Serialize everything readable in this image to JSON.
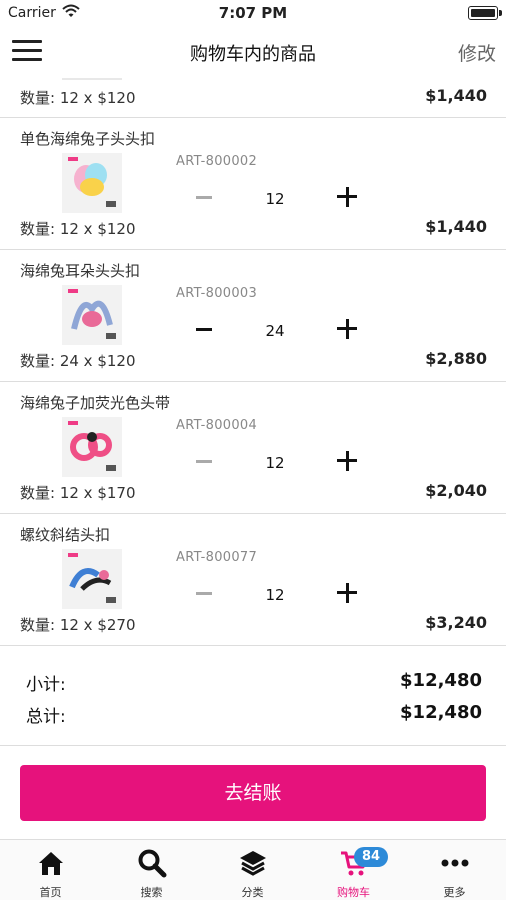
{
  "status_bar": {
    "carrier": "Carrier",
    "time": "7:07 PM"
  },
  "nav": {
    "title": "购物车内的商品",
    "edit_label": "修改"
  },
  "partial_item": {
    "line": "数量: 12 x $120",
    "total": "$1,440"
  },
  "items": [
    {
      "name": "单色海绵兔子头头扣",
      "sku": "ART-800002",
      "qty": "12",
      "line": "数量: 12 x $120",
      "total": "$1,440",
      "minus_active": false,
      "thumb_color": "#f3b3c9"
    },
    {
      "name": "海绵兔耳朵头头扣",
      "sku": "ART-800003",
      "qty": "24",
      "line": "数量: 24 x $120",
      "total": "$2,880",
      "minus_active": true,
      "thumb_color": "#8fa6d6"
    },
    {
      "name": "海绵兔子加荧光色头带",
      "sku": "ART-800004",
      "qty": "12",
      "line": "数量: 12 x $170",
      "total": "$2,040",
      "minus_active": false,
      "thumb_color": "#ef4f86"
    },
    {
      "name": "螺纹斜结头扣",
      "sku": "ART-800077",
      "qty": "12",
      "line": "数量: 12 x $270",
      "total": "$3,240",
      "minus_active": false,
      "thumb_color": "#3f7fd4"
    }
  ],
  "summary": {
    "subtotal_label": "小计:",
    "subtotal_value": "$12,480",
    "total_label": "总计:",
    "total_value": "$12,480"
  },
  "checkout": {
    "label": "去结账"
  },
  "tabs": [
    {
      "label": "首页",
      "icon": "home-icon"
    },
    {
      "label": "搜索",
      "icon": "search-icon"
    },
    {
      "label": "分类",
      "icon": "layers-icon"
    },
    {
      "label": "购物车",
      "icon": "cart-icon",
      "badge": "84",
      "active": true
    },
    {
      "label": "更多",
      "icon": "more-icon"
    }
  ],
  "colors": {
    "accent": "#e6127c",
    "badge": "#2d8ad8"
  }
}
